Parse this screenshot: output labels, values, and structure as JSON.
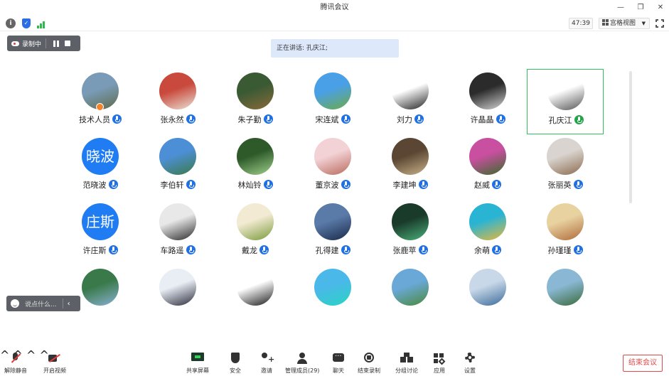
{
  "window": {
    "title": "腾讯会议",
    "controls": {
      "minimize": "—",
      "maximize": "❐",
      "close": "✕"
    }
  },
  "statusbar": {
    "info": "i",
    "shield": "✓",
    "timer": "47:39",
    "view_label": "宫格视图"
  },
  "recording": {
    "label": "录制中"
  },
  "speaking": {
    "label": "正在讲话: 孔庆江;"
  },
  "participants": [
    {
      "name": "技术人员",
      "avatar": "photo",
      "colors": [
        "#7a9bb8",
        "#5c6b4a"
      ],
      "host": true
    },
    {
      "name": "张永然",
      "avatar": "photo",
      "colors": [
        "#c94a3d",
        "#e9e2d6"
      ]
    },
    {
      "name": "朱子勤",
      "avatar": "photo",
      "colors": [
        "#3a5a34",
        "#8a6a3a"
      ]
    },
    {
      "name": "宋连斌",
      "avatar": "photo",
      "colors": [
        "#4aa0e6",
        "#6caa4a"
      ]
    },
    {
      "name": "刘力",
      "avatar": "photo",
      "colors": [
        "#ffffff",
        "#222222"
      ]
    },
    {
      "name": "许晶晶",
      "avatar": "photo",
      "colors": [
        "#2b2b2b",
        "#d4d4d4"
      ]
    },
    {
      "name": "孔庆江",
      "avatar": "photo",
      "colors": [
        "#ffffff",
        "#555555"
      ],
      "active": true,
      "mic": "green"
    },
    {
      "name": "范晓波",
      "avatar": "text",
      "text": "晓波"
    },
    {
      "name": "李伯轩",
      "avatar": "photo",
      "colors": [
        "#4d8fd6",
        "#3b7a4a"
      ]
    },
    {
      "name": "林灿铃",
      "avatar": "photo",
      "colors": [
        "#2e5a2a",
        "#9fd08c"
      ]
    },
    {
      "name": "董京波",
      "avatar": "photo",
      "colors": [
        "#f3d2d6",
        "#b86a5c"
      ]
    },
    {
      "name": "李建坤",
      "avatar": "photo",
      "colors": [
        "#5a4632",
        "#c8b28a"
      ]
    },
    {
      "name": "赵威",
      "avatar": "photo",
      "colors": [
        "#c94fa0",
        "#3a6a2a"
      ]
    },
    {
      "name": "张丽英",
      "avatar": "photo",
      "colors": [
        "#d9d4cf",
        "#8a6a4e"
      ]
    },
    {
      "name": "许庄斯",
      "avatar": "text",
      "text": "庄斯"
    },
    {
      "name": "车路遥",
      "avatar": "photo",
      "colors": [
        "#e8e8e8",
        "#2a2a2a"
      ]
    },
    {
      "name": "戴龙",
      "avatar": "photo",
      "colors": [
        "#f2ead2",
        "#7a9a3a"
      ]
    },
    {
      "name": "孔得建",
      "avatar": "photo",
      "colors": [
        "#5a7aa8",
        "#1a2a4a"
      ]
    },
    {
      "name": "张鹿苹",
      "avatar": "photo",
      "colors": [
        "#1a3a2a",
        "#4ab07a"
      ]
    },
    {
      "name": "余萌",
      "avatar": "photo",
      "colors": [
        "#2ab4d4",
        "#e8b83a"
      ]
    },
    {
      "name": "孙瑾瑾",
      "avatar": "photo",
      "colors": [
        "#e8d2a0",
        "#b06a3a"
      ]
    },
    {
      "name": "",
      "avatar": "photo",
      "colors": [
        "#3a7a4a",
        "#8ab0d4"
      ]
    },
    {
      "name": "",
      "avatar": "photo",
      "colors": [
        "#e8eef4",
        "#2a2a3a"
      ]
    },
    {
      "name": "",
      "avatar": "photo",
      "colors": [
        "#ffffff",
        "#1a1a1a"
      ]
    },
    {
      "name": "",
      "avatar": "photo",
      "colors": [
        "#4ab8e8",
        "#2ad4c4"
      ]
    },
    {
      "name": "",
      "avatar": "photo",
      "colors": [
        "#6aa8d8",
        "#4a8a3a"
      ]
    },
    {
      "name": "",
      "avatar": "photo",
      "colors": [
        "#c8d8e8",
        "#3a6a9a"
      ]
    },
    {
      "name": "",
      "avatar": "photo",
      "colors": [
        "#8ab8d4",
        "#3a6a3a"
      ]
    }
  ],
  "chat": {
    "placeholder": "说点什么...",
    "chevron": "‹"
  },
  "toolbar": {
    "caret": "^",
    "items": [
      {
        "key": "mute",
        "label": "解除静音"
      },
      {
        "key": "video",
        "label": "开启视频"
      },
      {
        "key": "share",
        "label": "共享屏幕"
      },
      {
        "key": "security",
        "label": "安全"
      },
      {
        "key": "invite",
        "label": "邀请"
      },
      {
        "key": "members",
        "label": "管理成员(29)"
      },
      {
        "key": "chat",
        "label": "聊天"
      },
      {
        "key": "record",
        "label": "结束录制"
      },
      {
        "key": "breakout",
        "label": "分组讨论"
      },
      {
        "key": "apps",
        "label": "应用"
      },
      {
        "key": "settings",
        "label": "设置"
      }
    ],
    "end_label": "结束会议"
  }
}
